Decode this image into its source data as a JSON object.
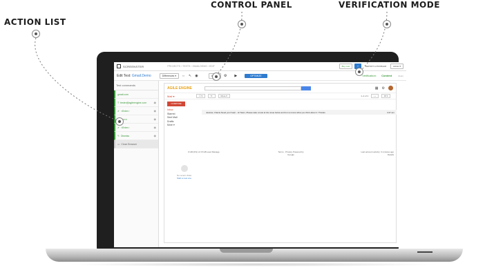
{
  "callouts": {
    "action_list": "ACTION LIST",
    "control_panel": "CONTROL PANEL",
    "verification_mode": "VERIFICATION MODE"
  },
  "app": {
    "brand": "SCREENSTER",
    "breadcrumb": "PROJECTS  ›  TESTS  ›  GMAILDEMO  ›  EDIT",
    "buy_label": "Buy now",
    "report_label": "REPORT A PROBLEM",
    "admin_label": "Admin ▾",
    "help_label": "?"
  },
  "toolbar": {
    "edit_prefix": "Edit Test:",
    "test_name": "Gmail.Demo",
    "mode_select": "Differences ▾",
    "view_select": "View ▾",
    "optimize_label": "OPTIMIZE",
    "verification_label": "Verification:",
    "verification_value": "Content",
    "zoom_label": "Zoom"
  },
  "sidebar": {
    "header": "Test commands",
    "items": [
      {
        "label": "gmail.com"
      },
      {
        "label": "tester@agileengine.com"
      },
      {
        "label": "<Enter>"
      },
      {
        "label": "••••••••"
      },
      {
        "label": "<Enter>"
      },
      {
        "label": "Dismiss"
      },
      {
        "label": "Close Browser"
      }
    ]
  },
  "gmail": {
    "logo": "AGILE ENGINE",
    "mail_label": "Mail ▾",
    "compose_label": "COMPOSE",
    "more_label": "More ▾",
    "count_label": "1–1 of 1",
    "nav": [
      "Inbox",
      "Starred",
      "Sent Mail",
      "Drafts",
      "More ▾"
    ],
    "message": {
      "from": "Jessica, Chantu",
      "subject": "Need your help! - Hi Team, Please take a look at the issue below and let me know what you think about it. Thanks.",
      "time": "4:47 am"
    },
    "storage": "0 GB (0%) of 15 GB used  Manage",
    "terms": "Terms · Privacy  Powered by Google",
    "activity": "Last account activity: 3 minutes ago  Details",
    "hangouts_1": "No recent chats",
    "hangouts_2": "Start a new one"
  },
  "colors": {
    "accent": "#2e7bcf",
    "success": "#3a9a3a",
    "gmail_red": "#d14836"
  }
}
